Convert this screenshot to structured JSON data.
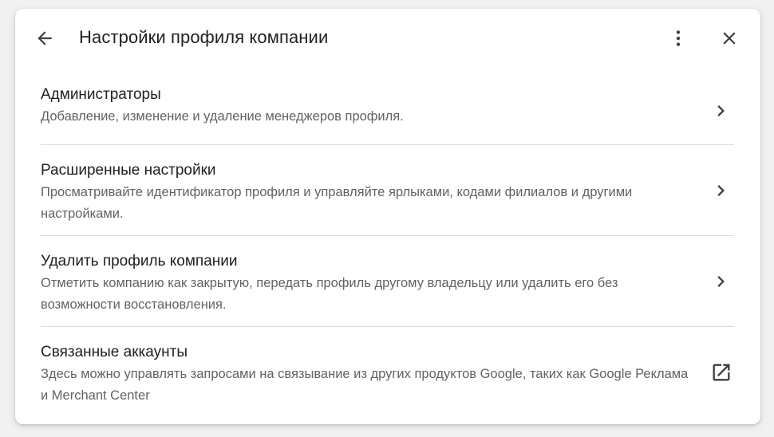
{
  "dialog": {
    "title": "Настройки профиля компании",
    "icons": {
      "back": "arrow-back-icon",
      "more": "more-vert-icon",
      "close": "close-icon"
    }
  },
  "items": [
    {
      "title": "Администраторы",
      "description": "Добавление, изменение и удаление менеджеров профиля.",
      "icon": "chevron-right-icon"
    },
    {
      "title": "Расширенные настройки",
      "description": "Просматривайте идентификатор профиля и управляйте ярлыками, кодами филиалов и другими настройками.",
      "icon": "chevron-right-icon"
    },
    {
      "title": "Удалить профиль компании",
      "description": "Отметить компанию как закрытую, передать профиль другому владельцу или удалить его без возможности восстановления.",
      "icon": "chevron-right-icon"
    },
    {
      "title": "Связанные аккаунты",
      "description": "Здесь можно управлять запросами на связывание из других продуктов Google, таких как Google Реклама и Merchant Center",
      "icon": "open-in-new-icon"
    }
  ],
  "colors": {
    "text_primary": "#202124",
    "text_secondary": "#5f6368",
    "divider": "#dadce0"
  }
}
